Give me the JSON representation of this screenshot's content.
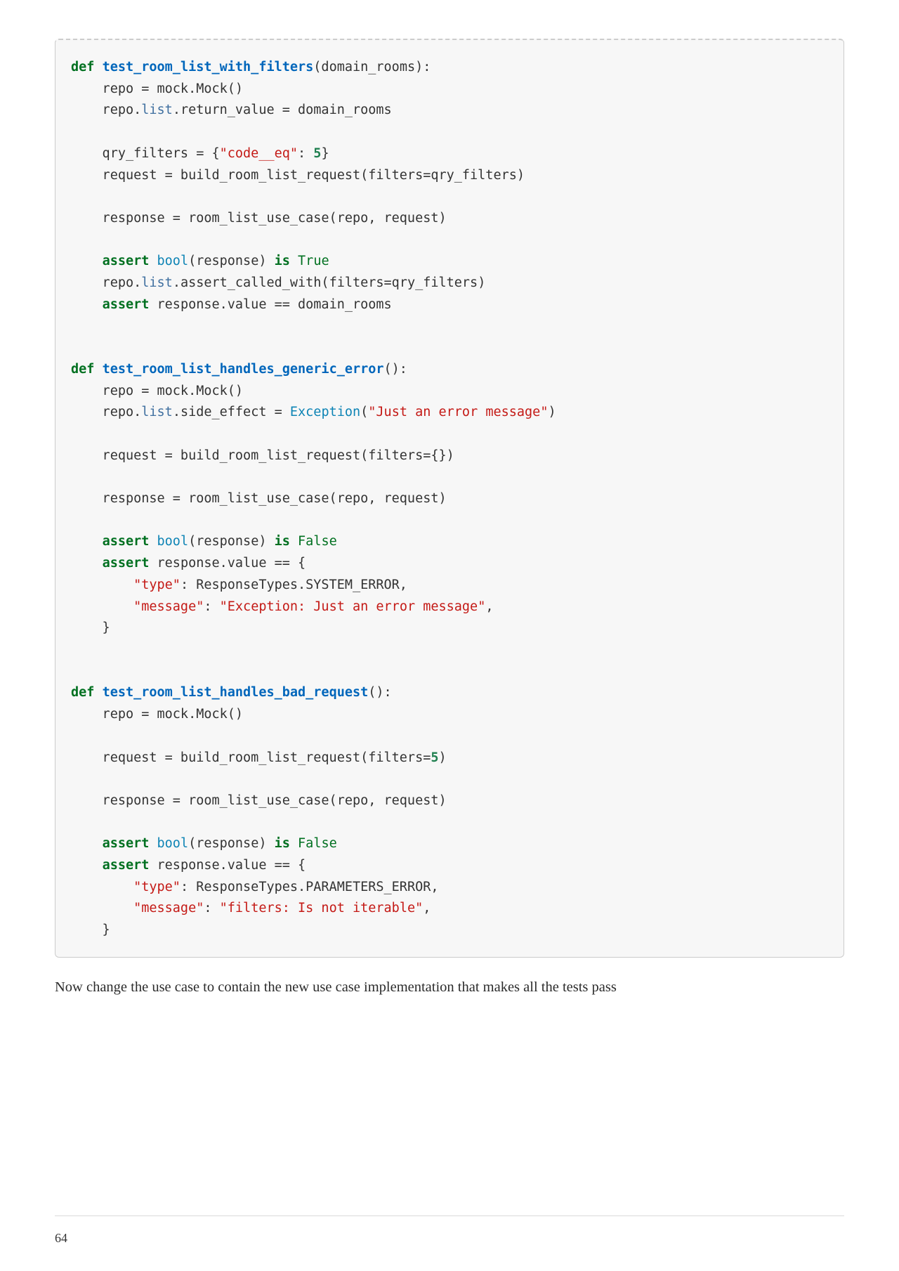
{
  "code": {
    "func1": {
      "def": "def",
      "name": "test_room_list_with_filters",
      "params": "(domain_rooms):",
      "l1a": "    repo = mock.Mock()",
      "l2a": "    repo.",
      "l2b": "list",
      "l2c": ".return_value = domain_rooms",
      "l3a": "    qry_filters = {",
      "l3b": "\"code__eq\"",
      "l3c": ": ",
      "l3d": "5",
      "l3e": "}",
      "l4": "    request = build_room_list_request(filters=qry_filters)",
      "l5": "    response = room_list_use_case(repo, request)",
      "l6a": "    ",
      "l6b": "assert",
      "l6c": " ",
      "l6d": "bool",
      "l6e": "(response) ",
      "l6f": "is",
      "l6g": " ",
      "l6h": "True",
      "l7a": "    repo.",
      "l7b": "list",
      "l7c": ".assert_called_with(filters=qry_filters)",
      "l8a": "    ",
      "l8b": "assert",
      "l8c": " response.value == domain_rooms"
    },
    "func2": {
      "def": "def",
      "name": "test_room_list_handles_generic_error",
      "params": "():",
      "l1": "    repo = mock.Mock()",
      "l2a": "    repo.",
      "l2b": "list",
      "l2c": ".side_effect = ",
      "l2d": "Exception",
      "l2e": "(",
      "l2f": "\"Just an error message\"",
      "l2g": ")",
      "l3": "    request = build_room_list_request(filters={})",
      "l4": "    response = room_list_use_case(repo, request)",
      "l5a": "    ",
      "l5b": "assert",
      "l5c": " ",
      "l5d": "bool",
      "l5e": "(response) ",
      "l5f": "is",
      "l5g": " ",
      "l5h": "False",
      "l6a": "    ",
      "l6b": "assert",
      "l6c": " response.value == {",
      "l7a": "        ",
      "l7b": "\"type\"",
      "l7c": ": ResponseTypes.SYSTEM_ERROR,",
      "l8a": "        ",
      "l8b": "\"message\"",
      "l8c": ": ",
      "l8d": "\"Exception: Just an error message\"",
      "l8e": ",",
      "l9": "    }"
    },
    "func3": {
      "def": "def",
      "name": "test_room_list_handles_bad_request",
      "params": "():",
      "l1": "    repo = mock.Mock()",
      "l2a": "    request = build_room_list_request(filters=",
      "l2b": "5",
      "l2c": ")",
      "l3": "    response = room_list_use_case(repo, request)",
      "l4a": "    ",
      "l4b": "assert",
      "l4c": " ",
      "l4d": "bool",
      "l4e": "(response) ",
      "l4f": "is",
      "l4g": " ",
      "l4h": "False",
      "l5a": "    ",
      "l5b": "assert",
      "l5c": " response.value == {",
      "l6a": "        ",
      "l6b": "\"type\"",
      "l6c": ": ResponseTypes.PARAMETERS_ERROR,",
      "l7a": "        ",
      "l7b": "\"message\"",
      "l7c": ": ",
      "l7d": "\"filters: Is not iterable\"",
      "l7e": ",",
      "l8": "    }"
    }
  },
  "body_text": "Now change the use case to contain the new use case implementation that makes all the tests pass",
  "page_number": "64"
}
